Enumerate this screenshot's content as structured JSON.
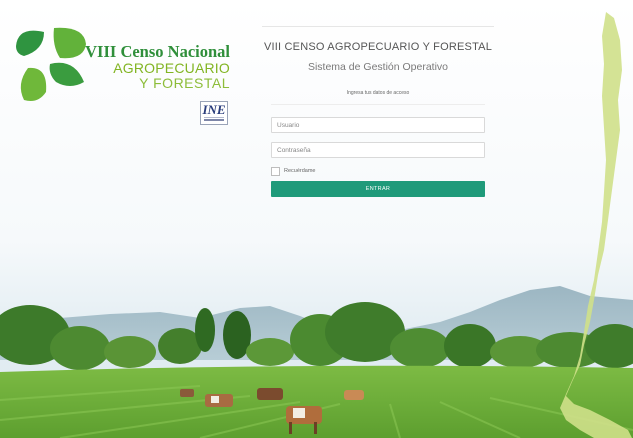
{
  "logo": {
    "line1": "VIII Censo Nacional",
    "line2": "AGROPECUARIO",
    "line3": "Y FORESTAL",
    "badge": "INE"
  },
  "login": {
    "title": "VIII CENSO AGROPECUARIO Y FORESTAL",
    "subtitle": "Sistema de Gestión Operativo",
    "instructions": "Ingresa tus datos de acceso",
    "username_placeholder": "Usuario",
    "username_value": "",
    "password_placeholder": "Contraseña",
    "password_value": "",
    "remember_label": "Recuérdame",
    "remember_checked": false,
    "submit_label": "ENTRAR"
  },
  "colors": {
    "accent": "#1f9a7a",
    "logo_green_dark": "#2f8f3a",
    "logo_green_light": "#82b523",
    "map_green": "#cfe08a",
    "field_green": "#6fae3a"
  },
  "icons": {
    "logo_mark": "green-leaves-icon",
    "badge": "ine-logo-icon",
    "map": "chile-map-silhouette"
  }
}
